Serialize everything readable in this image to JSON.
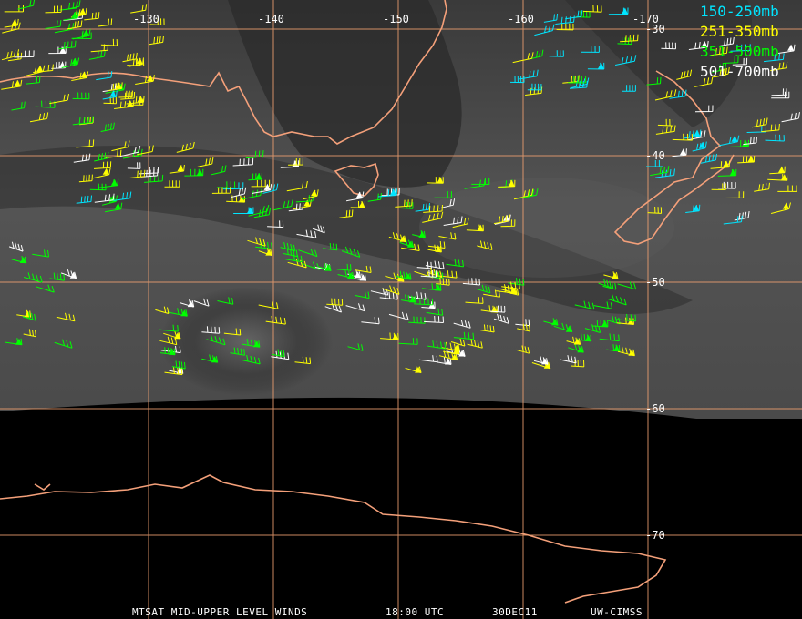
{
  "map": {
    "longitude_labels": [
      "-130",
      "-140",
      "-150",
      "-160",
      "-170"
    ],
    "latitude_labels": [
      "-30",
      "-40",
      "-50",
      "-60",
      "-70"
    ],
    "grid_color": "#f0a070",
    "coast_color": "#f4a07a"
  },
  "legend": [
    {
      "label": "150-250mb",
      "color": "#00e5ff"
    },
    {
      "label": "251-350mb",
      "color": "#ffff00"
    },
    {
      "label": "351-500mb",
      "color": "#00ff00"
    },
    {
      "label": "501-700mb",
      "color": "#ffffff"
    }
  ],
  "footer": {
    "product": "MTSAT MID-UPPER LEVEL WINDS",
    "time": "18:00 UTC",
    "date": "30DEC11",
    "source": "UW-CIMSS"
  }
}
